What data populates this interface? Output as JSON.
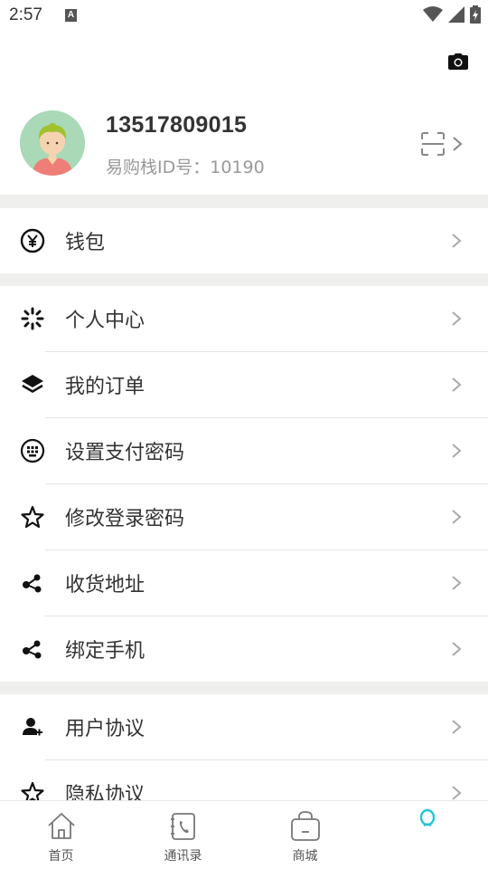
{
  "status_bar": {
    "time": "2:57",
    "badge": "A"
  },
  "profile": {
    "phone": "13517809015",
    "id_line": "易购栈ID号：10190"
  },
  "wallet": {
    "label": "钱包"
  },
  "menu_group_1": [
    {
      "label": "个人中心",
      "icon": "personal-center-icon"
    },
    {
      "label": "我的订单",
      "icon": "layers-icon"
    },
    {
      "label": "设置支付密码",
      "icon": "keypad-icon"
    },
    {
      "label": "修改登录密码",
      "icon": "star-icon"
    },
    {
      "label": "收货地址",
      "icon": "share-icon"
    },
    {
      "label": "绑定手机",
      "icon": "share-icon"
    }
  ],
  "menu_group_2": [
    {
      "label": "用户协议",
      "icon": "user-add-icon"
    },
    {
      "label": "隐私协议",
      "icon": "star-icon"
    }
  ],
  "tabbar": {
    "tabs": [
      {
        "label": "首页",
        "icon": "home-icon"
      },
      {
        "label": "通讯录",
        "icon": "contacts-phone-icon"
      },
      {
        "label": "商城",
        "icon": "shopping-bag-icon"
      },
      {
        "label": "",
        "icon": "profile-icon"
      }
    ],
    "active_color": "#25c4d6"
  }
}
